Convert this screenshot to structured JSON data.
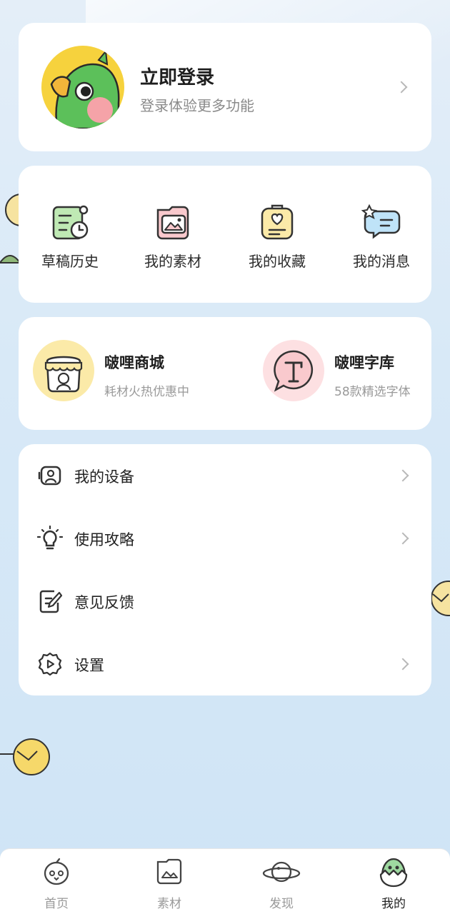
{
  "login": {
    "title": "立即登录",
    "subtitle": "登录体验更多功能",
    "avatar_icon": "parrot-avatar-icon"
  },
  "quick_actions": [
    {
      "label": "草稿历史",
      "icon": "draft-history-icon"
    },
    {
      "label": "我的素材",
      "icon": "my-materials-icon"
    },
    {
      "label": "我的收藏",
      "icon": "my-favorites-icon"
    },
    {
      "label": "我的消息",
      "icon": "my-messages-icon"
    }
  ],
  "promos": [
    {
      "title": "啵哩商城",
      "subtitle": "耗材火热优惠中",
      "icon": "store-icon"
    },
    {
      "title": "啵哩字库",
      "subtitle": "58款精选字体",
      "icon": "font-library-icon"
    }
  ],
  "menu": [
    {
      "label": "我的设备",
      "icon": "device-icon",
      "chevron": true
    },
    {
      "label": "使用攻略",
      "icon": "lightbulb-icon",
      "chevron": true
    },
    {
      "label": "意见反馈",
      "icon": "feedback-icon",
      "chevron": false
    },
    {
      "label": "设置",
      "icon": "settings-icon",
      "chevron": true
    }
  ],
  "bottom_nav": [
    {
      "label": "首页",
      "icon": "home-icon",
      "active": false
    },
    {
      "label": "素材",
      "icon": "materials-icon",
      "active": false
    },
    {
      "label": "发现",
      "icon": "discover-planet-icon",
      "active": false
    },
    {
      "label": "我的",
      "icon": "profile-icon",
      "active": true
    }
  ],
  "colors": {
    "background": "#d8e9f7",
    "card": "#ffffff",
    "avatar_bg": "#f6d23d",
    "parrot_green": "#5cc05a",
    "icon_green": "#bfe9b4",
    "icon_pink": "#f9c9cd",
    "icon_yellow": "#fbeaa8",
    "icon_blue": "#bfe3f8",
    "text_primary": "#222222",
    "text_secondary": "#8a8a8a"
  }
}
